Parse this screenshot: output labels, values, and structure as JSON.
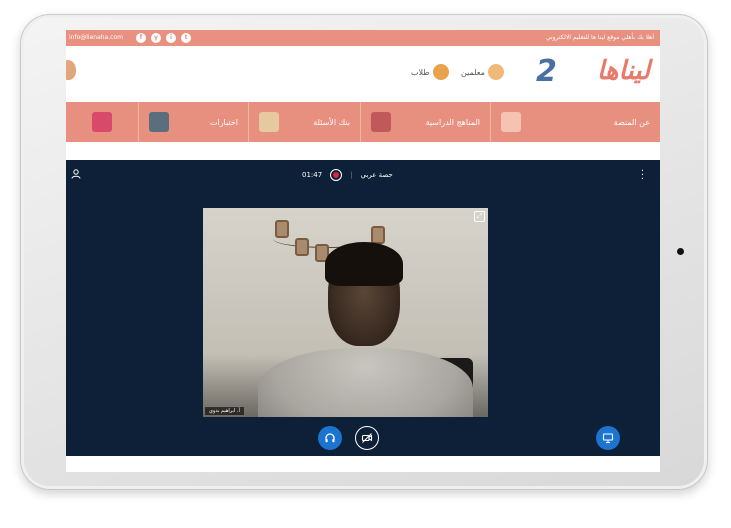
{
  "topbar": {
    "email": "info@lienaha.com",
    "welcome": "أهلا بك بأهلي موقع لينا ها للتعليم الالكتروني",
    "social": [
      "f",
      "y",
      "i",
      "t"
    ]
  },
  "header": {
    "logo_text": "ليناها",
    "logo_number": "2",
    "teachers_label": "معلمين",
    "students_label": "طلاب"
  },
  "nav": {
    "items": [
      {
        "label": "عن المنصة",
        "icon": "about-icon"
      },
      {
        "label": "المناهج الدراسية",
        "icon": "books-icon"
      },
      {
        "label": "بنك الأسئلة",
        "icon": "question-bank-icon"
      },
      {
        "label": "اختبارات",
        "icon": "exams-icon"
      },
      {
        "label": "",
        "icon": "video-lessons-icon"
      }
    ]
  },
  "conference": {
    "timer": "01:47",
    "session_title": "حصة عربي",
    "participant_name": "أ. ابراهيم بدوي",
    "colors": {
      "background": "#0e2038",
      "accent": "#1b75d0",
      "record": "#d9263a"
    }
  }
}
